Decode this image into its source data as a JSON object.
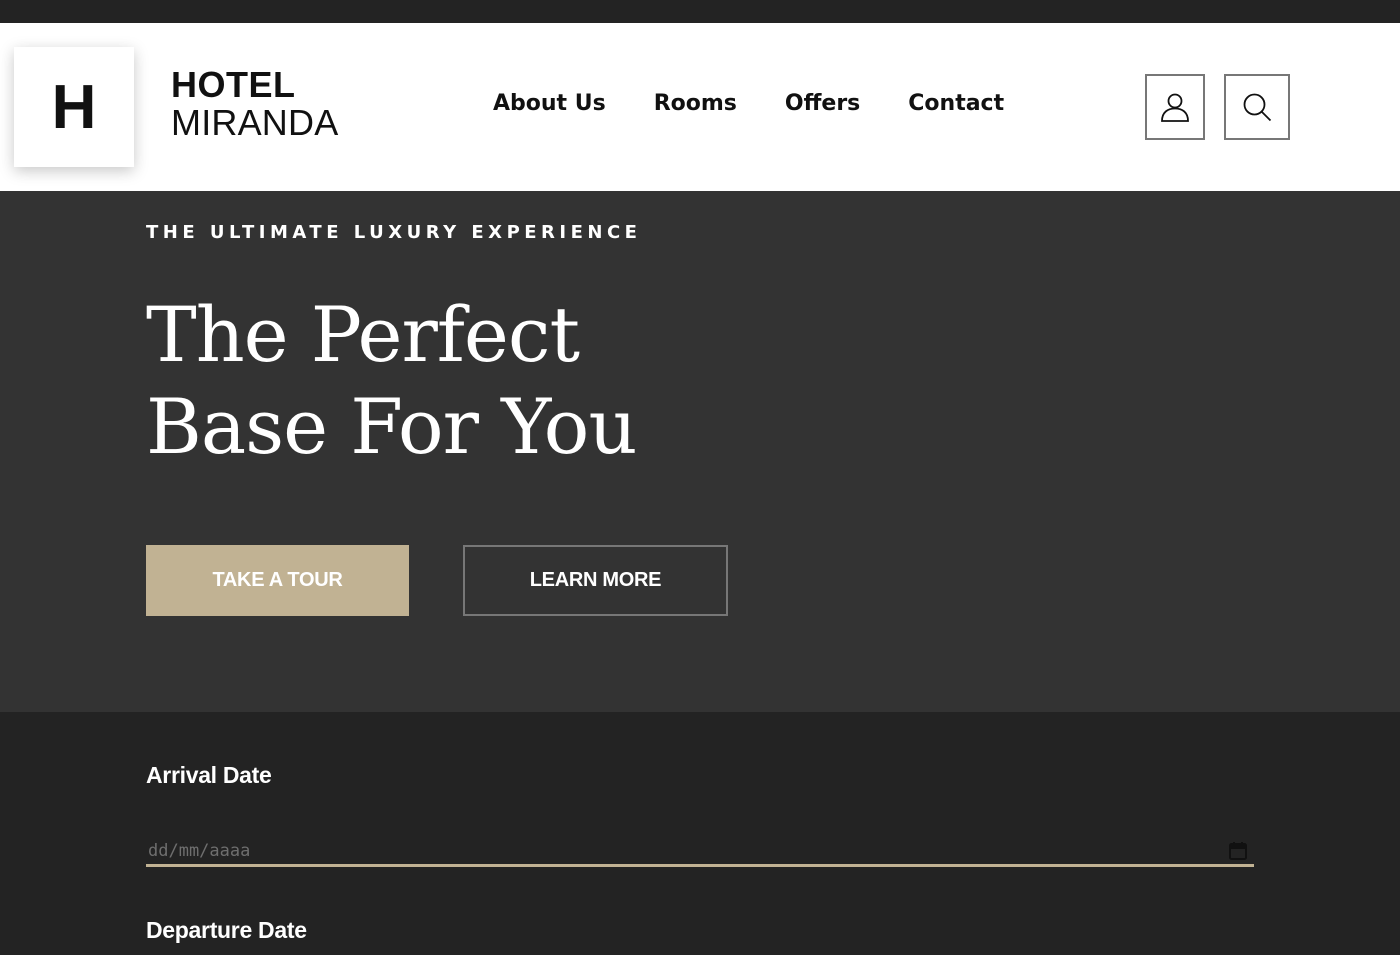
{
  "header": {
    "logo_letter": "H",
    "brand_line1": "HOTEL",
    "brand_line2": "MIRANDA",
    "nav": [
      {
        "label": "About Us"
      },
      {
        "label": "Rooms"
      },
      {
        "label": "Offers"
      },
      {
        "label": "Contact"
      }
    ],
    "icons": {
      "user": "user-icon",
      "search": "search-icon"
    }
  },
  "hero": {
    "eyebrow": "THE ULTIMATE LUXURY EXPERIENCE",
    "headline_line1": "The Perfect",
    "headline_line2": "Base For You",
    "primary_button": "TAKE A TOUR",
    "secondary_button": "LEARN MORE"
  },
  "booking": {
    "arrival_label": "Arrival Date",
    "arrival_placeholder": "dd/mm/aaaa",
    "departure_label": "Departure Date",
    "calendar_icon": "calendar-icon"
  },
  "colors": {
    "accent": "#c1b293",
    "hero_bg": "#333333",
    "booking_bg": "#232323",
    "header_bg": "#ffffff"
  }
}
